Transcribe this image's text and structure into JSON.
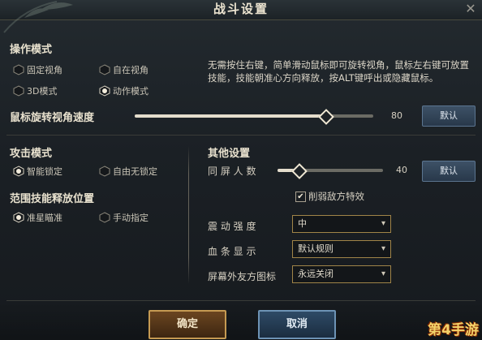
{
  "window": {
    "title": "战斗设置"
  },
  "operation_mode": {
    "title": "操作模式",
    "options": [
      {
        "label": "固定视角",
        "selected": false
      },
      {
        "label": "自在视角",
        "selected": false
      },
      {
        "label": "3D模式",
        "selected": false
      },
      {
        "label": "动作模式",
        "selected": true
      }
    ],
    "description": "无需按住右键，简单滑动鼠标即可旋转视角，鼠标左右键可放置技能，技能朝准心方向释放，按ALT键呼出或隐藏鼠标。"
  },
  "mouse_speed": {
    "label": "鼠标旋转视角速度",
    "value": "80",
    "level": 0.8,
    "reset_label": "默认"
  },
  "attack_mode": {
    "title": "攻击模式",
    "options": [
      {
        "label": "智能锁定",
        "selected": true
      },
      {
        "label": "自由无锁定",
        "selected": false
      }
    ]
  },
  "aoe_position": {
    "title": "范围技能释放位置",
    "options": [
      {
        "label": "准星瞄准",
        "selected": true
      },
      {
        "label": "手动指定",
        "selected": false
      }
    ]
  },
  "other": {
    "title": "其他设置",
    "same_screen": {
      "label": "同 屏 人 数",
      "value": "40",
      "level": 0.2,
      "reset_label": "默认"
    },
    "weaken_effects": {
      "label": "削弱敌方特效",
      "checked": true,
      "check_glyph": "✔"
    },
    "shake": {
      "label": "震 动 强 度",
      "value": "中"
    },
    "hp_bar": {
      "label": "血 条 显 示",
      "value": "默认规则"
    },
    "offscreen_icon": {
      "label": "屏幕外友方图标",
      "value": "永远关闭"
    }
  },
  "footer": {
    "confirm_label": "确定",
    "cancel_label": "取消"
  },
  "watermark": "第4手游",
  "icons": {
    "close": "close-icon",
    "chevron": "chevron-down-icon"
  },
  "colors": {
    "accent_gold": "#c59a52",
    "accent_blue": "#6d93b5"
  }
}
